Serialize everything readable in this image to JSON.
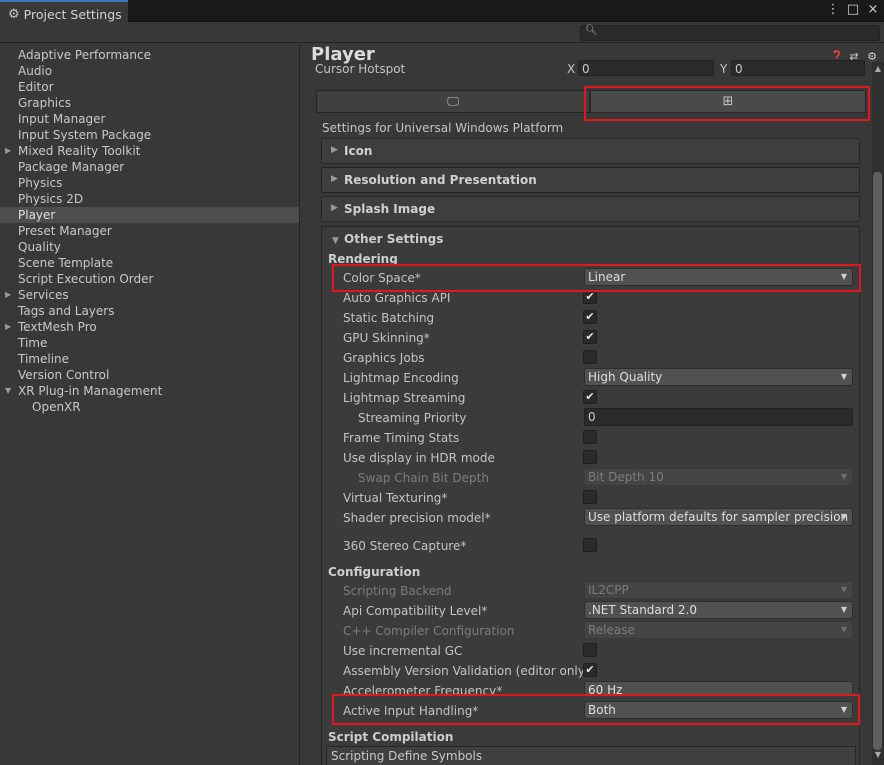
{
  "window": {
    "title": "Project Settings",
    "controls": [
      "⋮",
      "□",
      "×"
    ]
  },
  "search": {
    "placeholder": ""
  },
  "sidebar": {
    "items": [
      {
        "label": "Adaptive Performance"
      },
      {
        "label": "Audio"
      },
      {
        "label": "Editor"
      },
      {
        "label": "Graphics"
      },
      {
        "label": "Input Manager"
      },
      {
        "label": "Input System Package"
      },
      {
        "label": "Mixed Reality Toolkit",
        "foldout": "collapsed"
      },
      {
        "label": "Package Manager"
      },
      {
        "label": "Physics"
      },
      {
        "label": "Physics 2D"
      },
      {
        "label": "Player",
        "selected": true
      },
      {
        "label": "Preset Manager"
      },
      {
        "label": "Quality"
      },
      {
        "label": "Scene Template"
      },
      {
        "label": "Script Execution Order"
      },
      {
        "label": "Services",
        "foldout": "collapsed"
      },
      {
        "label": "Tags and Layers"
      },
      {
        "label": "TextMesh Pro",
        "foldout": "collapsed"
      },
      {
        "label": "Time"
      },
      {
        "label": "Timeline"
      },
      {
        "label": "Version Control"
      },
      {
        "label": "XR Plug-in Management",
        "foldout": "expanded"
      },
      {
        "label": "OpenXR",
        "child": true
      }
    ]
  },
  "panel": {
    "title": "Player",
    "header_icons": [
      "help-icon",
      "preset-icon",
      "gear-icon"
    ],
    "cursor_hotspot": {
      "label": "Cursor Hotspot",
      "x_label": "X",
      "x_value": "0",
      "y_label": "Y",
      "y_value": "0"
    },
    "platform_tabs": [
      "desktop-icon",
      "windows-icon"
    ],
    "settings_for": "Settings for Universal Windows Platform",
    "foldouts": {
      "icon": "Icon",
      "resolution": "Resolution and Presentation",
      "splash": "Splash Image",
      "other": "Other Settings"
    },
    "rendering": {
      "header": "Rendering",
      "color_space_label": "Color Space*",
      "color_space_value": "Linear",
      "auto_graphics_api": "Auto Graphics API",
      "static_batching": "Static Batching",
      "gpu_skinning": "GPU Skinning*",
      "graphics_jobs": "Graphics Jobs",
      "lightmap_encoding_label": "Lightmap Encoding",
      "lightmap_encoding_value": "High Quality",
      "lightmap_streaming": "Lightmap Streaming",
      "streaming_priority_label": "Streaming Priority",
      "streaming_priority_value": "0",
      "frame_timing_stats": "Frame Timing Stats",
      "hdr_mode": "Use display in HDR mode",
      "swap_chain_label": "Swap Chain Bit Depth",
      "swap_chain_value": "Bit Depth 10",
      "virtual_texturing": "Virtual Texturing*",
      "shader_precision_label": "Shader precision model*",
      "shader_precision_value": "Use platform defaults for sampler precision",
      "stereo_capture": "360 Stereo Capture*"
    },
    "checkbox_states": {
      "auto_graphics_api": true,
      "static_batching": true,
      "gpu_skinning": true,
      "graphics_jobs": false,
      "lightmap_streaming": true,
      "frame_timing_stats": false,
      "hdr_mode": false,
      "virtual_texturing": false,
      "stereo_capture": false,
      "incremental_gc": false,
      "assembly_validation": true
    },
    "configuration": {
      "header": "Configuration",
      "scripting_backend_label": "Scripting Backend",
      "scripting_backend_value": "IL2CPP",
      "api_compat_label": "Api Compatibility Level*",
      "api_compat_value": ".NET Standard 2.0",
      "cpp_compiler_label": "C++ Compiler Configuration",
      "cpp_compiler_value": "Release",
      "incremental_gc": "Use incremental GC",
      "assembly_validation": "Assembly Version Validation (editor only)",
      "accelerometer_label": "Accelerometer Frequency*",
      "accelerometer_value": "60 Hz",
      "active_input_label": "Active Input Handling*",
      "active_input_value": "Both"
    },
    "script_compilation": {
      "header": "Script Compilation",
      "define_symbols": "Scripting Define Symbols"
    }
  },
  "colors": {
    "highlight": "#e0181e",
    "selected_tab_accent": "#3a79bb"
  }
}
